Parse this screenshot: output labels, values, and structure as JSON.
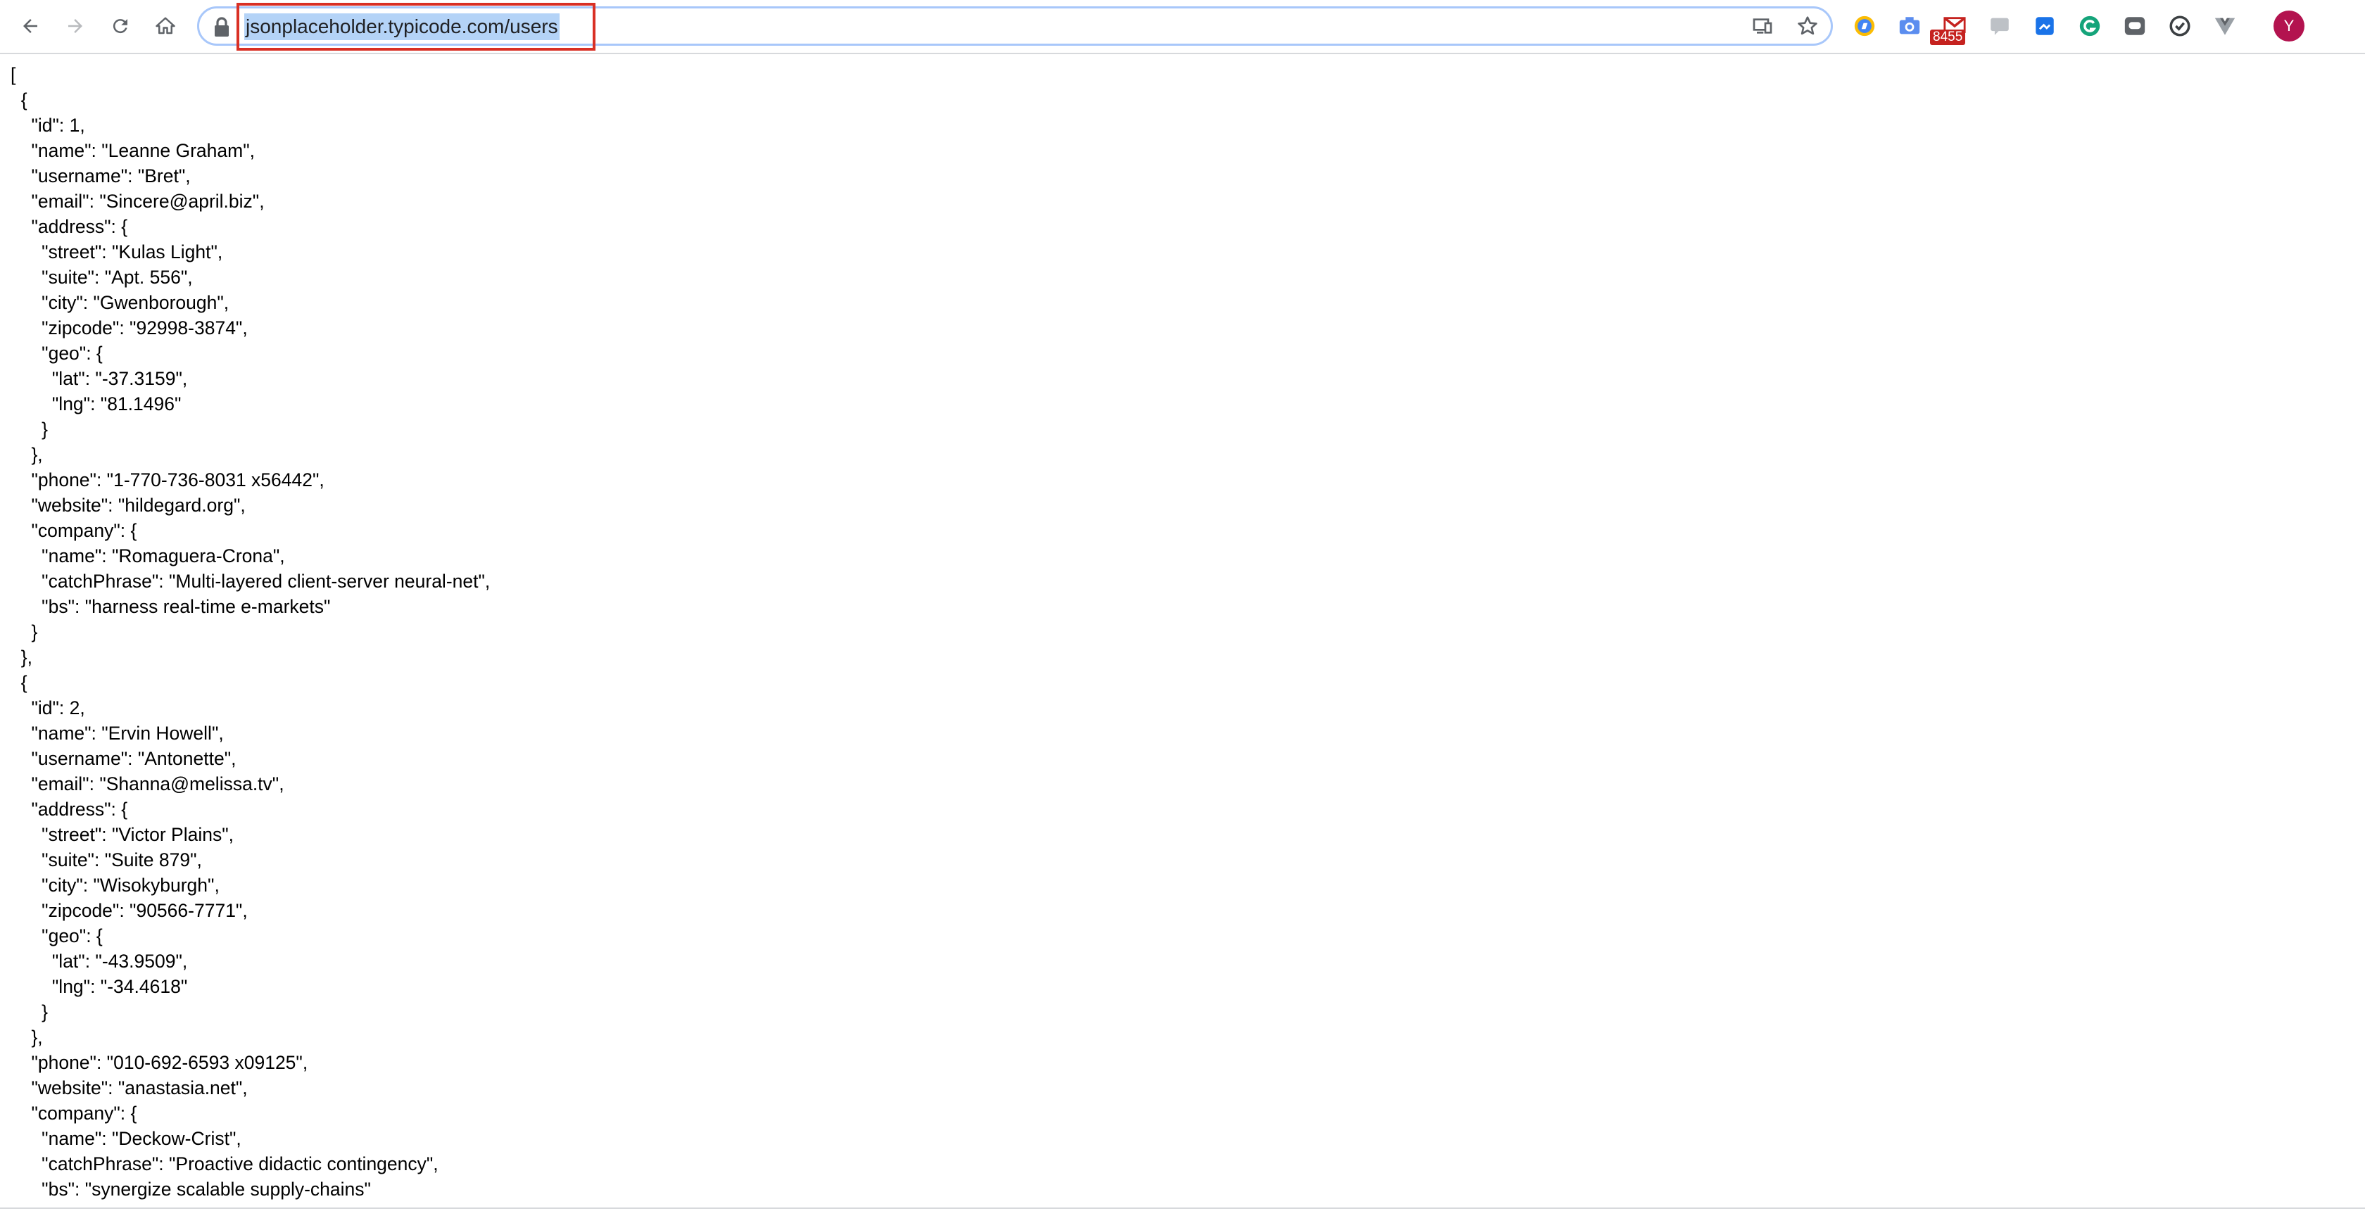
{
  "browser": {
    "url": "jsonplaceholder.typicode.com/users",
    "extension_badge": "8455",
    "avatar_initial": "Y",
    "colors": {
      "url_highlight_border": "#d93025",
      "url_selection": "#b4d3f7",
      "avatar": "#b3134f",
      "badge": "#c5221f"
    },
    "icons": [
      "back-icon",
      "forward-icon",
      "reload-icon",
      "home-icon",
      "lock-icon",
      "cast-icon",
      "star-icon"
    ]
  },
  "page": {
    "json_lines": [
      "[",
      "  {",
      "    \"id\": 1,",
      "    \"name\": \"Leanne Graham\",",
      "    \"username\": \"Bret\",",
      "    \"email\": \"Sincere@april.biz\",",
      "    \"address\": {",
      "      \"street\": \"Kulas Light\",",
      "      \"suite\": \"Apt. 556\",",
      "      \"city\": \"Gwenborough\",",
      "      \"zipcode\": \"92998-3874\",",
      "      \"geo\": {",
      "        \"lat\": \"-37.3159\",",
      "        \"lng\": \"81.1496\"",
      "      }",
      "    },",
      "    \"phone\": \"1-770-736-8031 x56442\",",
      "    \"website\": \"hildegard.org\",",
      "    \"company\": {",
      "      \"name\": \"Romaguera-Crona\",",
      "      \"catchPhrase\": \"Multi-layered client-server neural-net\",",
      "      \"bs\": \"harness real-time e-markets\"",
      "    }",
      "  },",
      "  {",
      "    \"id\": 2,",
      "    \"name\": \"Ervin Howell\",",
      "    \"username\": \"Antonette\",",
      "    \"email\": \"Shanna@melissa.tv\",",
      "    \"address\": {",
      "      \"street\": \"Victor Plains\",",
      "      \"suite\": \"Suite 879\",",
      "      \"city\": \"Wisokyburgh\",",
      "      \"zipcode\": \"90566-7771\",",
      "      \"geo\": {",
      "        \"lat\": \"-43.9509\",",
      "        \"lng\": \"-34.4618\"",
      "      }",
      "    },",
      "    \"phone\": \"010-692-6593 x09125\",",
      "    \"website\": \"anastasia.net\",",
      "    \"company\": {",
      "      \"name\": \"Deckow-Crist\",",
      "      \"catchPhrase\": \"Proactive didactic contingency\",",
      "      \"bs\": \"synergize scalable supply-chains\""
    ]
  }
}
